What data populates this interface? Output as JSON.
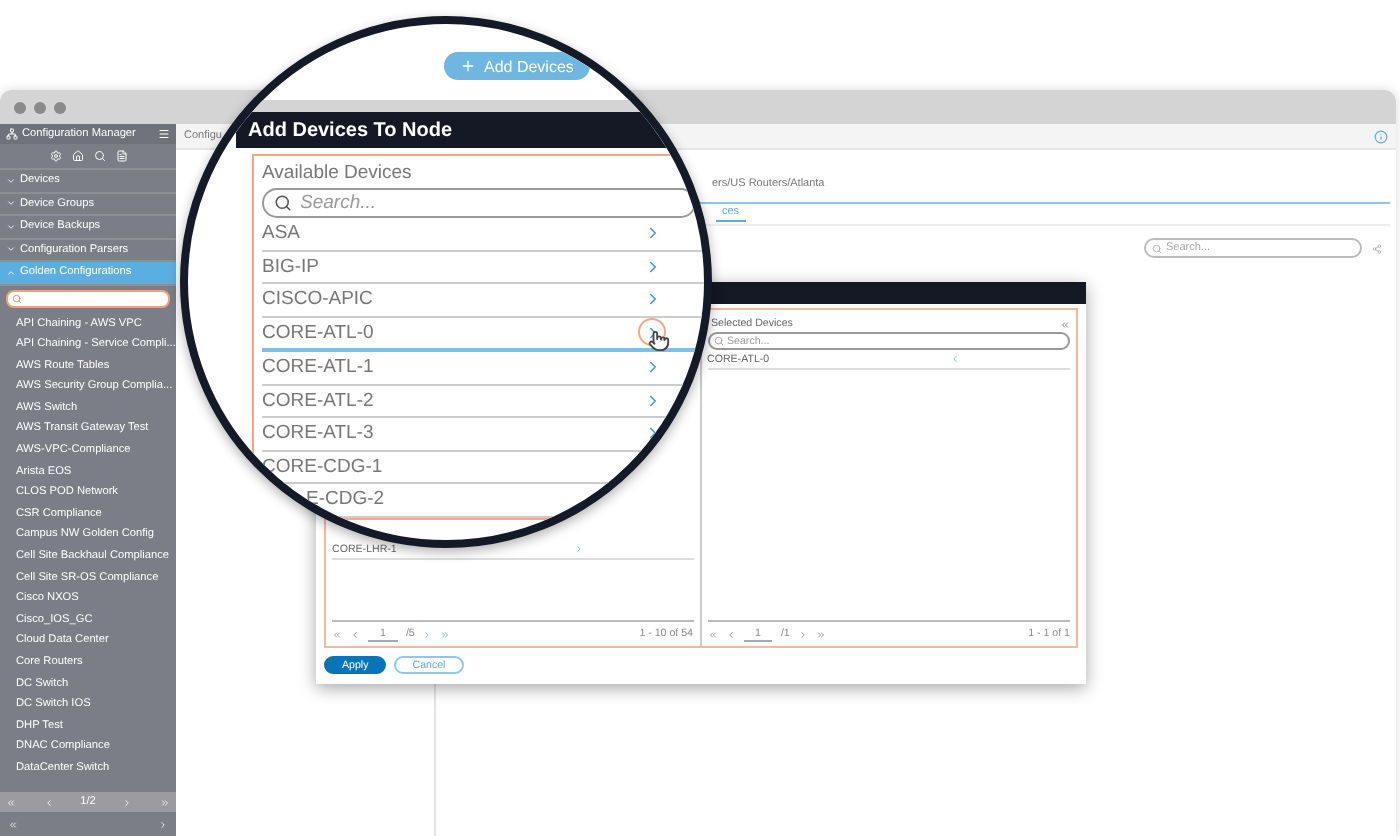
{
  "add_devices_button": "Add Devices",
  "sidebar": {
    "title": "Configuration Manager",
    "sections": [
      {
        "label": "Devices",
        "expanded": false,
        "selected": false
      },
      {
        "label": "Device Groups",
        "expanded": false,
        "selected": false
      },
      {
        "label": "Device Backups",
        "expanded": false,
        "selected": false
      },
      {
        "label": "Configuration Parsers",
        "expanded": false,
        "selected": false
      },
      {
        "label": "Golden Configurations",
        "expanded": true,
        "selected": true
      }
    ],
    "items": [
      "API Chaining - AWS VPC",
      "API Chaining - Service Compli...",
      "AWS Route Tables",
      "AWS Security Group Complia...",
      "AWS Switch",
      "AWS Transit Gateway Test",
      "AWS-VPC-Compliance",
      "Arista EOS",
      "CLOS POD Network",
      "CSR Compliance",
      "Campus NW Golden Config",
      "Cell Site Backhaul Compliance",
      "Cell Site SR-OS Compliance",
      "Cisco NXOS",
      "Cisco_IOS_GC",
      "Cloud Data Center",
      "Core Routers",
      "DC Switch",
      "DC Switch IOS",
      "DHP Test",
      "DNAC Compliance",
      "DataCenter Switch"
    ],
    "pager": "1/2"
  },
  "main": {
    "title": "Configu",
    "breadcrumb": "ers/US Routers/Atlanta",
    "tab": "ces",
    "search": {
      "placeholder": "Search..."
    }
  },
  "dialog": {
    "title": "Add Devices To Node",
    "available": {
      "heading": "Available Devices",
      "search": {
        "placeholder": "Search..."
      },
      "rows": [
        {
          "name": "ASA",
          "hovered": false,
          "kind": "link"
        },
        {
          "name": "BIG-IP",
          "hovered": false,
          "kind": "link"
        },
        {
          "name": "CISCO-APIC",
          "hovered": false,
          "kind": "link"
        },
        {
          "name": "CORE-ATL-0",
          "hovered": true,
          "kind": "link"
        },
        {
          "name": "CORE-ATL-1",
          "hovered": false,
          "kind": "link"
        },
        {
          "name": "CORE-ATL-2",
          "hovered": false,
          "kind": "link"
        },
        {
          "name": "CORE-ATL-3",
          "hovered": false,
          "kind": "link"
        },
        {
          "name": "CORE-CDG-1",
          "hovered": false,
          "kind": "plain"
        },
        {
          "name": "E-CDG-2",
          "hovered": false,
          "kind": "cut"
        }
      ],
      "rows_below": [
        "CORE-LHR-1"
      ],
      "page": "1",
      "pages": "/5",
      "count": "1 - 10 of 54"
    },
    "selected": {
      "heading": "Selected Devices",
      "search": {
        "placeholder": "Search..."
      },
      "rows": [
        "CORE-ATL-0"
      ],
      "page": "1",
      "pages": "/1",
      "count": "1 - 1 of 1"
    },
    "buttons": [
      {
        "label": "Apply",
        "kind": "primary"
      },
      {
        "label": "Cancel",
        "kind": "secondary"
      }
    ]
  }
}
